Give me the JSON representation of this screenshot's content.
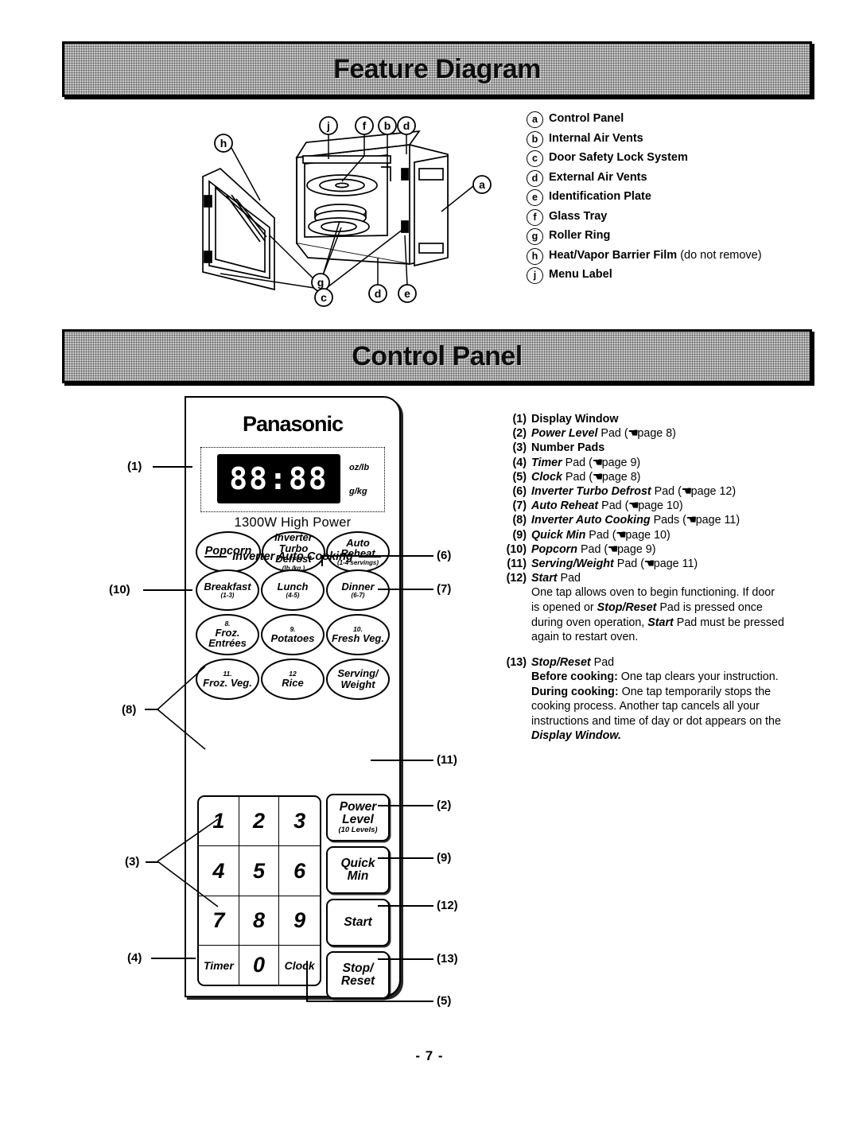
{
  "page": {
    "number_label": "- 7 -"
  },
  "sections": {
    "feature_diagram": {
      "banner_title": "Feature Diagram",
      "legend": [
        {
          "key": "a",
          "label": "Control Panel",
          "note": ""
        },
        {
          "key": "b",
          "label": "Internal Air Vents",
          "note": ""
        },
        {
          "key": "c",
          "label": "Door Safety Lock System",
          "note": ""
        },
        {
          "key": "d",
          "label": "External Air Vents",
          "note": ""
        },
        {
          "key": "e",
          "label": "Identification Plate",
          "note": ""
        },
        {
          "key": "f",
          "label": "Glass Tray",
          "note": ""
        },
        {
          "key": "g",
          "label": "Roller Ring",
          "note": ""
        },
        {
          "key": "h",
          "label": "Heat/Vapor Barrier Film",
          "note": " (do not remove)"
        },
        {
          "key": "j",
          "label": "Menu Label",
          "note": ""
        }
      ],
      "diagram_markers": [
        "j",
        "f",
        "b",
        "d",
        "h",
        "a",
        "g",
        "c",
        "d",
        "e"
      ]
    },
    "control_panel": {
      "banner_title": "Control Panel",
      "items": [
        {
          "num": "(1)",
          "bold": "Display Window",
          "italic": "",
          "after": "",
          "ref": ""
        },
        {
          "num": "(2)",
          "bold": "",
          "italic": "Power Level",
          "after": " Pad (",
          "ref": "page 8)"
        },
        {
          "num": "(3)",
          "bold": "Number Pads",
          "italic": "",
          "after": "",
          "ref": ""
        },
        {
          "num": "(4)",
          "bold": "",
          "italic": "Timer",
          "after": " Pad (",
          "ref": "page 9)"
        },
        {
          "num": "(5)",
          "bold": "",
          "italic": "Clock",
          "after": " Pad (",
          "ref": "page 8)"
        },
        {
          "num": "(6)",
          "bold": "",
          "italic": "Inverter Turbo Defrost",
          "after": " Pad (",
          "ref": "page 12)"
        },
        {
          "num": "(7)",
          "bold": "",
          "italic": "Auto Reheat",
          "after": " Pad (",
          "ref": "page 10)"
        },
        {
          "num": "(8)",
          "bold": "",
          "italic": "Inverter Auto Cooking",
          "after": " Pads (",
          "ref": "page 11)"
        },
        {
          "num": "(9)",
          "bold": "",
          "italic": "Quick Min",
          "after": " Pad (",
          "ref": "page 10)"
        },
        {
          "num": "(10)",
          "bold": "",
          "italic": "Popcorn",
          "after": " Pad (",
          "ref": "page 9)"
        },
        {
          "num": "(11)",
          "bold": "",
          "italic": "Serving/Weight",
          "after": " Pad (",
          "ref": "page 11)"
        },
        {
          "num": "(12)",
          "bold": "",
          "italic": "Start",
          "after": " Pad",
          "ref": ""
        }
      ],
      "start_paragraph": {
        "line1_a": "One tap allows oven to begin functioning. If door",
        "line2_a": "is opened or ",
        "line2_i": "Stop/Reset",
        "line2_b": " Pad is pressed once",
        "line3_a": "during oven operation, ",
        "line3_i": "Start",
        "line3_b": " Pad must be pressed",
        "line4_a": "again to restart oven."
      },
      "stop_reset": {
        "num": "(13)",
        "italic": "Stop/Reset",
        "after": " Pad",
        "before_label": "Before cooking:",
        "before_text": " One tap clears your instruction.",
        "during_label": "During cooking:",
        "during_text": " One tap temporarily stops the",
        "body_line2": "cooking process. Another tap cancels all your",
        "body_line3": "instructions and time of day or dot appears on the",
        "body_line4_i": "Display Window."
      },
      "device": {
        "brand": "Panasonic",
        "display_value": "88:88",
        "unit_top": "oz/lb",
        "unit_bottom": "g/kg",
        "wattage": "1300W High Power",
        "top_pads": [
          {
            "label": "Popcorn",
            "sub": ""
          },
          {
            "label": "Inverter\nTurbo\nDefrost",
            "sub": "(lb./kg.)"
          },
          {
            "label": "Auto\nReheat",
            "sub": "(1-4 servings)"
          }
        ],
        "auto_cooking_header": "Inverter Auto Cooking",
        "auto_cooking_pads": [
          {
            "num": "",
            "label": "Breakfast",
            "sub": "(1-3)"
          },
          {
            "num": "",
            "label": "Lunch",
            "sub": "(4-5)"
          },
          {
            "num": "",
            "label": "Dinner",
            "sub": "(6-7)"
          },
          {
            "num": "8.",
            "label": "Froz.\nEntrées",
            "sub": ""
          },
          {
            "num": "9.",
            "label": "Potatoes",
            "sub": ""
          },
          {
            "num": "10.",
            "label": "Fresh Veg.",
            "sub": ""
          },
          {
            "num": "11.",
            "label": "Froz. Veg.",
            "sub": ""
          },
          {
            "num": "12",
            "label": "Rice",
            "sub": ""
          },
          {
            "num": "",
            "label": "Serving/\nWeight",
            "sub": ""
          }
        ],
        "number_keys": [
          "1",
          "2",
          "3",
          "4",
          "5",
          "6",
          "7",
          "8",
          "9",
          "Timer",
          "0",
          "Clock"
        ],
        "side_keys": [
          {
            "label": "Power\nLevel",
            "sub": "(10 Levels)"
          },
          {
            "label": "Quick\nMin",
            "sub": ""
          },
          {
            "label": "Start",
            "sub": ""
          },
          {
            "label": "Stop/\nReset",
            "sub": ""
          }
        ]
      },
      "callouts_left": [
        "(1)",
        "(10)",
        "(8)",
        "(3)",
        "(4)"
      ],
      "callouts_right": [
        "(6)",
        "(7)",
        "(11)",
        "(2)",
        "(9)",
        "(12)",
        "(13)",
        "(5)"
      ]
    }
  }
}
